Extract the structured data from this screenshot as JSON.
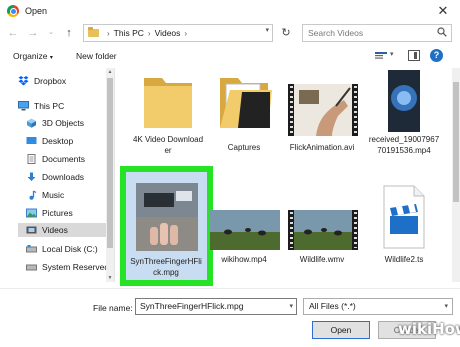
{
  "window": {
    "title": "Open"
  },
  "address": {
    "crumbs": [
      "This PC",
      "Videos"
    ]
  },
  "search": {
    "placeholder": "Search Videos"
  },
  "toolbar": {
    "organize_label": "Organize",
    "new_folder_label": "New folder"
  },
  "sidebar": {
    "items": [
      {
        "label": "Dropbox",
        "icon": "dropbox-icon"
      },
      {
        "label": "This PC",
        "icon": "computer-icon"
      },
      {
        "label": "3D Objects",
        "icon": "cube-icon"
      },
      {
        "label": "Desktop",
        "icon": "desktop-icon"
      },
      {
        "label": "Documents",
        "icon": "documents-icon"
      },
      {
        "label": "Downloads",
        "icon": "download-icon"
      },
      {
        "label": "Music",
        "icon": "music-icon"
      },
      {
        "label": "Pictures",
        "icon": "pictures-icon"
      },
      {
        "label": "Videos",
        "icon": "videos-icon",
        "selected": true
      },
      {
        "label": "Local Disk (C:)",
        "icon": "drive-icon"
      },
      {
        "label": "System Reserved",
        "icon": "drive-icon"
      }
    ]
  },
  "files": [
    {
      "name": "4K Video Downloader",
      "kind": "folder"
    },
    {
      "name": "Captures",
      "kind": "folder-open"
    },
    {
      "name": "FlickAnimation.avi",
      "kind": "video"
    },
    {
      "name": "received_1900796770191536.mp4",
      "kind": "video"
    },
    {
      "name": "SynThreeFingerHFlick.mpg",
      "kind": "video",
      "selected": true
    },
    {
      "name": "wikihow.mp4",
      "kind": "video"
    },
    {
      "name": "Wildlife.wmv",
      "kind": "video"
    },
    {
      "name": "Wildlife2.ts",
      "kind": "clapper"
    }
  ],
  "bottom": {
    "filename_label": "File name:",
    "filename_value": "SynThreeFingerHFlick.mpg",
    "filetype_value": "All Files (*.*)",
    "open_label": "Open",
    "cancel_label": "Cancel"
  },
  "watermark": {
    "wiki": "wiki",
    "how": "How"
  },
  "colors": {
    "highlight": "#26e326",
    "folder": "#e8bf58",
    "accent": "#2a6fd1"
  }
}
